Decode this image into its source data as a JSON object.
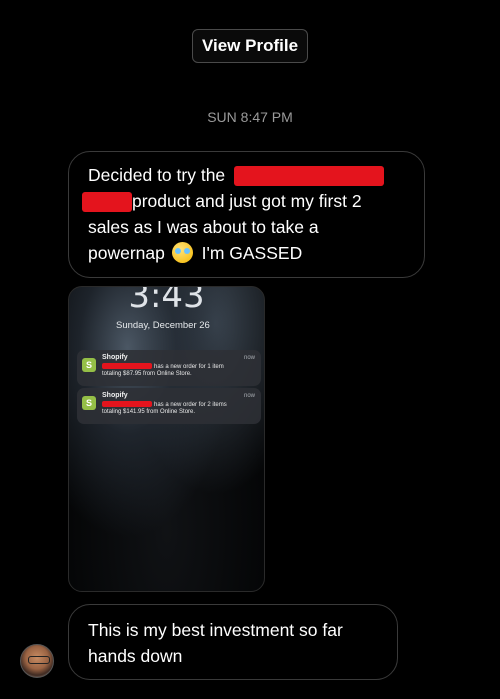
{
  "header": {
    "view_profile_label": "View Profile"
  },
  "thread": {
    "timestamp": "SUN 8:47 PM"
  },
  "message1": {
    "line1_prefix": "Decided to try the",
    "line2_suffix": "product and just got my first 2",
    "line3": "sales as I was about to take a",
    "line4_prefix": "powernap",
    "line4_suffix": "I'm GASSED",
    "emoji": "crying-face-emoji"
  },
  "screenshot": {
    "time": "3:43",
    "date": "Sunday, December 26",
    "notifications": [
      {
        "app": "Shopify",
        "time": "now",
        "line1": "has a new order for 1 item",
        "line2": "totaling $87.95 from Online Store."
      },
      {
        "app": "Shopify",
        "time": "now",
        "line1": "has a new order for 2 items",
        "line2": "totaling $141.95 from Online Store."
      }
    ]
  },
  "message2": {
    "line1": "This is my best investment so far",
    "line2": "hands down"
  },
  "colors": {
    "background": "#000000",
    "redaction": "#e4141d",
    "shopify_green": "#95bf47"
  }
}
